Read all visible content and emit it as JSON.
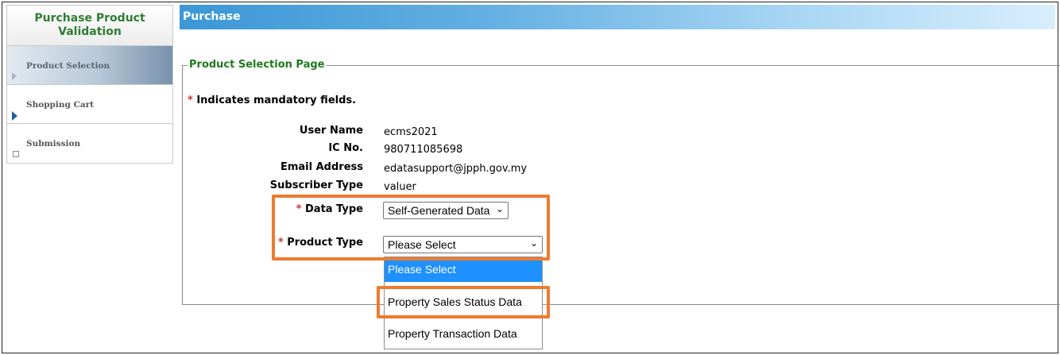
{
  "sidebar": {
    "title": "Purchase Product Validation",
    "items": [
      {
        "label": "Product Selection",
        "state": "active"
      },
      {
        "label": "Shopping Cart",
        "state": "current-arrow"
      },
      {
        "label": "Submission",
        "state": "pending"
      }
    ]
  },
  "header": {
    "title": "Purchase"
  },
  "form": {
    "legend": "Product Selection Page",
    "mandatory_star": "*",
    "mandatory_note": "Indicates mandatory fields.",
    "fields": {
      "user_name": {
        "label": "User Name",
        "value": "ecms2021"
      },
      "ic_no": {
        "label": "IC No.",
        "value": "980711085698"
      },
      "email": {
        "label": "Email Address",
        "value": "edatasupport@jpph.gov.my"
      },
      "subscriber_type": {
        "label": "Subscriber Type",
        "value": "valuer"
      },
      "data_type": {
        "label": "Data Type",
        "value": "Self-Generated Data"
      },
      "product_type": {
        "label": "Product Type",
        "value": "Please Select",
        "options": [
          "Please Select",
          "Property Sales Status Data",
          "Property Transaction Data"
        ]
      }
    }
  },
  "colors": {
    "header_gradient_start": "#3c97d6",
    "sidebar_title": "#2e7d32",
    "legend": "#1e7a1e",
    "required_star": "#d32f2f",
    "highlight": "#ee7b2f",
    "dropdown_selected": "#1e90ff"
  },
  "icons": {
    "dropdown": "chevron-down-icon",
    "sidebar_marker": "arrow-right-icon"
  }
}
